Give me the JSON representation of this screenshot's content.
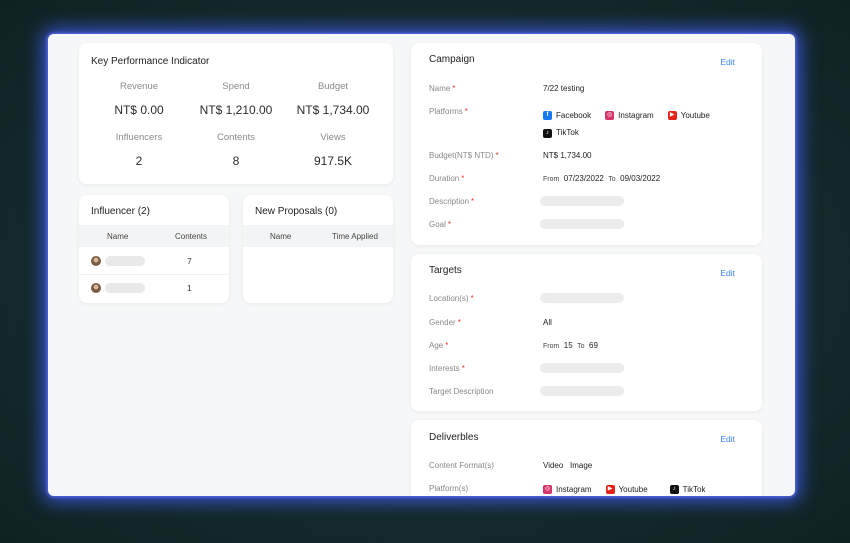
{
  "kpi": {
    "title": "Key Performance Indicator",
    "items": [
      {
        "label": "Revenue",
        "value": "NT$ 0.00"
      },
      {
        "label": "Spend",
        "value": "NT$ 1,210.00"
      },
      {
        "label": "Budget",
        "value": "NT$ 1,734.00"
      },
      {
        "label": "Influencers",
        "value": "2"
      },
      {
        "label": "Contents",
        "value": "8"
      },
      {
        "label": "Views",
        "value": "917.5K"
      }
    ]
  },
  "influencer": {
    "title": "Influencer (2)",
    "col_name": "Name",
    "col_contents": "Contents",
    "rows": [
      {
        "contents": "7"
      },
      {
        "contents": "1"
      }
    ]
  },
  "proposals": {
    "title": "New Proposals (0)",
    "col_name": "Name",
    "col_time": "Time Applied"
  },
  "edit_label": "Edit",
  "campaign": {
    "title": "Campaign",
    "name_label": "Name",
    "name_value": "7/22 testing",
    "platforms_label": "Platforms",
    "platforms": [
      "Facebook",
      "Instagram",
      "Youtube",
      "TikTok"
    ],
    "budget_label": "Budget(NT$ NTD)",
    "budget_value": "NT$ 1,734.00",
    "duration_label": "Duration",
    "from_label": "From",
    "from_date": "07/23/2022",
    "to_label": "To",
    "to_date": "09/03/2022",
    "description_label": "Description",
    "goal_label": "Goal"
  },
  "targets": {
    "title": "Targets",
    "location_label": "Location(s)",
    "gender_label": "Gender",
    "gender_value": "All",
    "age_label": "Age",
    "age_from_label": "From",
    "age_from": "15",
    "age_to_label": "To",
    "age_to": "69",
    "interests_label": "Interests",
    "target_desc_label": "Target Description"
  },
  "deliverables": {
    "title": "Deliverbles",
    "format_label": "Content Format(s)",
    "formats": [
      "Video",
      "Image"
    ],
    "platform_label": "Platform(s)",
    "platforms": [
      "Instagram",
      "Youtube",
      "TikTok"
    ]
  },
  "colors": {
    "accent": "#3b82f6",
    "required": "#e53935",
    "glow": "#465fff"
  }
}
